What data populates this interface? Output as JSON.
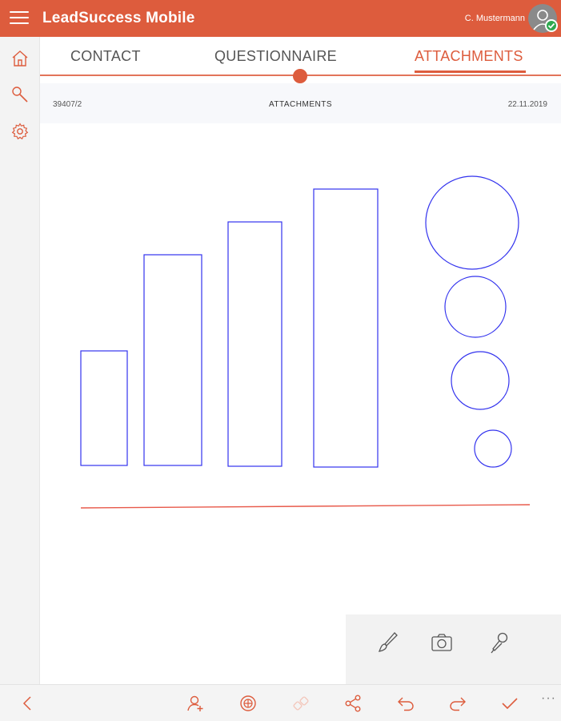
{
  "header": {
    "app_title": "LeadSuccess Mobile",
    "user_name": "C. Mustermann"
  },
  "tabs": [
    {
      "label": "CONTACT",
      "active": false
    },
    {
      "label": "QUESTIONNAIRE",
      "active": false
    },
    {
      "label": "ATTACHMENTS",
      "active": true
    }
  ],
  "info": {
    "record_id": "39407/2",
    "section_title": "ATTACHMENTS",
    "date": "22.11.2019"
  },
  "colors": {
    "accent": "#DD5C3D",
    "sketch_stroke": "#3333EE",
    "status_ok": "#2FA84F"
  },
  "icons": {
    "sidebar": [
      "home-icon",
      "search-icon",
      "gear-icon"
    ],
    "tools": [
      "brush-icon",
      "camera-icon",
      "microphone-icon"
    ],
    "bottom": [
      "back-icon",
      "add-contact-icon",
      "crosshair-icon",
      "link-icon",
      "share-icon",
      "undo-icon",
      "redo-icon",
      "check-icon",
      "more-icon"
    ]
  },
  "bottom": {
    "more_label": "···"
  }
}
